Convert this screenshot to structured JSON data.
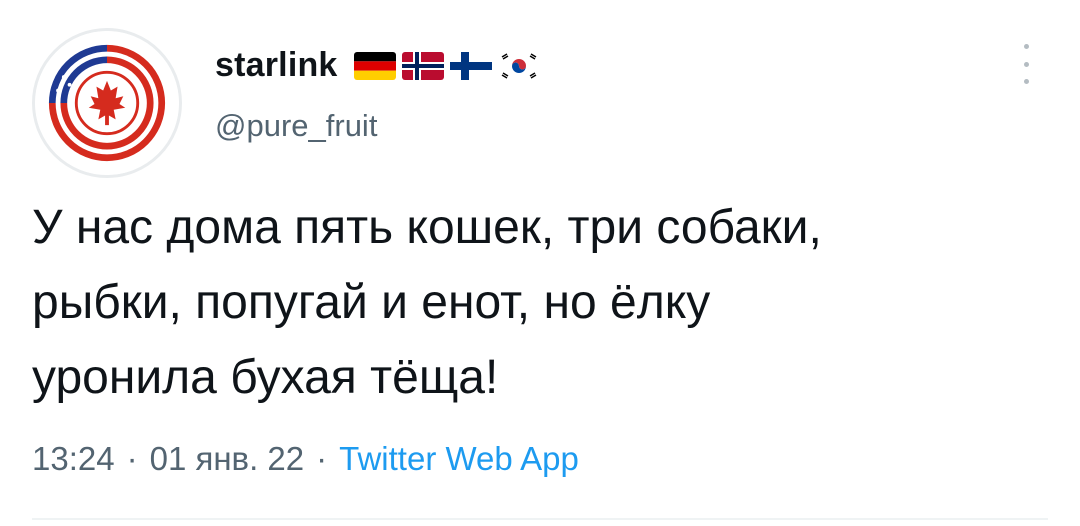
{
  "author": {
    "display_name": "starlink",
    "handle": "@pure_fruit",
    "avatar_icon": "canada-usa-flag-avatar-icon",
    "flags": [
      "germany-flag-icon",
      "norway-flag-icon",
      "finland-flag-icon",
      "south-korea-flag-icon"
    ]
  },
  "tweet": {
    "text": "У нас дома пять кошек, три собаки,\nрыбки, попугай и енот, но ёлку\nуронила бухая тёща!"
  },
  "meta": {
    "time": "13:24",
    "separator1": "·",
    "date": "01 янв. 22",
    "separator2": "·",
    "source": "Twitter Web App"
  },
  "colors": {
    "text": "#0f1419",
    "secondary": "#536471",
    "link": "#1d9bf0"
  }
}
